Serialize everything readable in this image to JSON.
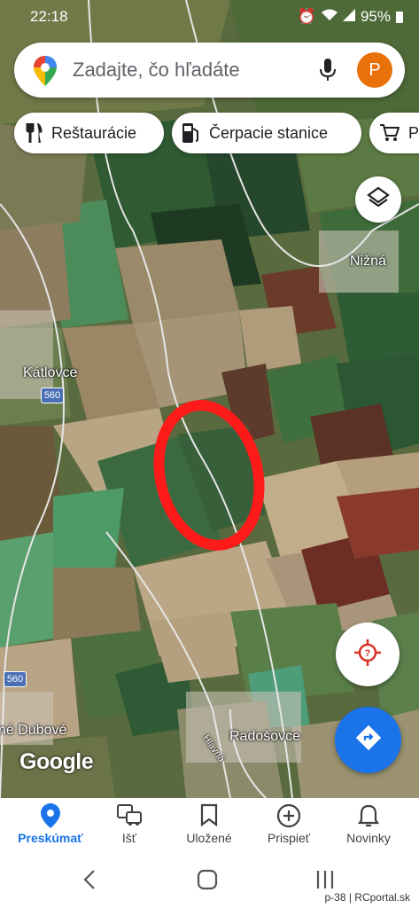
{
  "status_bar": {
    "time": "22:18",
    "battery": "95%"
  },
  "search": {
    "placeholder": "Zadajte, čo hľadáte",
    "avatar_letter": "P"
  },
  "chips": [
    {
      "label": "Reštaurácie",
      "icon": "restaurant-icon"
    },
    {
      "label": "Čerpacie stanice",
      "icon": "gas-station-icon"
    },
    {
      "label": "P",
      "icon": "shopping-cart-icon"
    }
  ],
  "map": {
    "places": [
      "Nižná",
      "Kátlovce",
      "Radošovce",
      "né Dubové"
    ],
    "road_shields": [
      "560",
      "560"
    ],
    "street_label": "Hlavná",
    "attribution": "Google",
    "annotation_color": "#ff1a1a"
  },
  "bottom_nav": [
    {
      "label": "Preskúmať",
      "icon": "explore-pin-icon",
      "active": true
    },
    {
      "label": "Išť",
      "icon": "commute-icon",
      "active": false
    },
    {
      "label": "Uložené",
      "icon": "bookmark-icon",
      "active": false
    },
    {
      "label": "Prispieť",
      "icon": "add-circle-icon",
      "active": false
    },
    {
      "label": "Novinky",
      "icon": "bell-icon",
      "active": false
    }
  ],
  "watermark": "p-38 | RCportal.sk",
  "colors": {
    "accent": "#1a73e8",
    "avatar": "#e8710a",
    "locate": "#d93025"
  }
}
